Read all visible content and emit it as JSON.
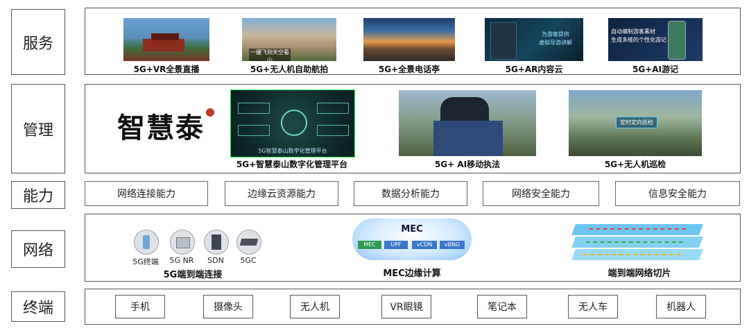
{
  "layers": {
    "service": "服务",
    "management": "管理",
    "capability": "能力",
    "network": "网络",
    "terminal": "终端"
  },
  "services": [
    {
      "caption": "5G+VR全景直播",
      "image": "mountain-temple-panorama-photo"
    },
    {
      "caption": "5G+无人机自助航拍",
      "image": "cliff-aerial-photo",
      "overlay": "一键飞到天空看山"
    },
    {
      "caption": "5G+全景电话亭",
      "image": "sunset-mountain-photo"
    },
    {
      "caption": "5G+AR内容云",
      "image": "ar-guide-photo",
      "overlay_lines": [
        "为游客提供",
        "虚拟导游讲解"
      ]
    },
    {
      "caption": "5G+AI游记",
      "image": "phone-app-screenshot",
      "overlay_lines": [
        "自动编制游客素材",
        "生成多维的个性化游记"
      ]
    }
  ],
  "management": {
    "logo_text": "智慧泰",
    "items": [
      {
        "caption": "5G+智慧泰山数字化管理平台",
        "image": "management-platform-screenshot",
        "overlay": "5G智慧泰山数字化管理平台"
      },
      {
        "caption": "5G+ AI移动执法",
        "image": "officer-ar-glasses-photo"
      },
      {
        "caption": "5G+无人机巡检",
        "image": "drone-inspection-photo",
        "overlay": "定时定向巡检"
      }
    ]
  },
  "capabilities": [
    "网络连接能力",
    "边缘云资源能力",
    "数据分析能力",
    "网络安全能力",
    "信息安全能力"
  ],
  "network": {
    "connect_caption": "5G端到端连接",
    "devices": [
      "5G终端",
      "5G NR",
      "SDN",
      "5GC"
    ],
    "mec_title": "MEC",
    "mec_modules": [
      "MEC",
      "UPF",
      "vCDN",
      "vBNG"
    ],
    "mec_caption": "MEC边缘计算",
    "slicing_caption": "端到端网络切片"
  },
  "terminals": [
    "手机",
    "摄像头",
    "无人机",
    "VR眼镜",
    "笔记本",
    "无人车",
    "机器人"
  ]
}
